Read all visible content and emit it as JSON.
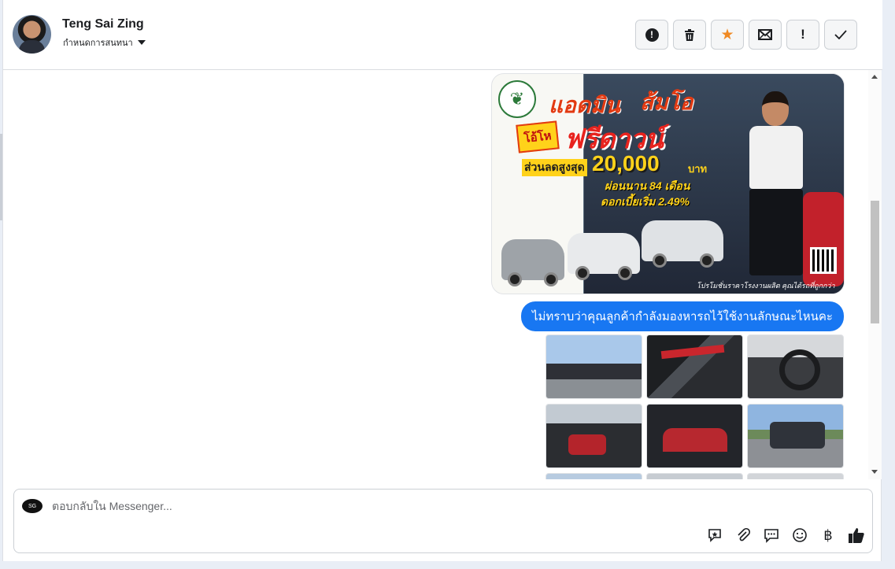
{
  "header": {
    "contact_name": "Teng Sai Zing",
    "assign_label": "กำหนดการสนทนา",
    "tools": [
      {
        "name": "spam-button",
        "icon": "alert-circle-icon"
      },
      {
        "name": "delete-button",
        "icon": "trash-icon"
      },
      {
        "name": "star-button",
        "icon": "star-icon"
      },
      {
        "name": "mark-unread-button",
        "icon": "envelope-icon"
      },
      {
        "name": "follow-up-button",
        "icon": "exclamation-icon"
      },
      {
        "name": "done-button",
        "icon": "checkmark-icon"
      }
    ]
  },
  "messages": {
    "promo_image": {
      "line1": "แอดมิน",
      "line1b": "ส้มโอ",
      "burst": "โอ้โห",
      "headline": "ฟรีดาวน์",
      "discount_label": "ส่วนลดสูงสุด",
      "discount_value": "20,000",
      "currency": "บาท",
      "installment": "ผ่อนนาน 84 เดือน",
      "interest": "ดอกเบี้ยเริ่ม 2.49%",
      "footer": "โปรโมชั่นราคาโรงงานผลิต คุณได้รถที่ถูกกว่า"
    },
    "outgoing_text": "ไม่ทราบว่าคุณลูกค้ากำลังมองหารถไว้ใช้งานลักษณะไหนคะ",
    "photo_count_visible": 9
  },
  "composer": {
    "placeholder": "ตอบกลับใน Messenger...",
    "avatar_text": "SG",
    "icons": [
      "sticker-icon",
      "attachment-icon",
      "saved-replies-icon",
      "emoji-icon",
      "baht-icon",
      "thumbs-up-icon"
    ]
  },
  "colors": {
    "accent": "#1877f2",
    "star": "#f08a24"
  }
}
